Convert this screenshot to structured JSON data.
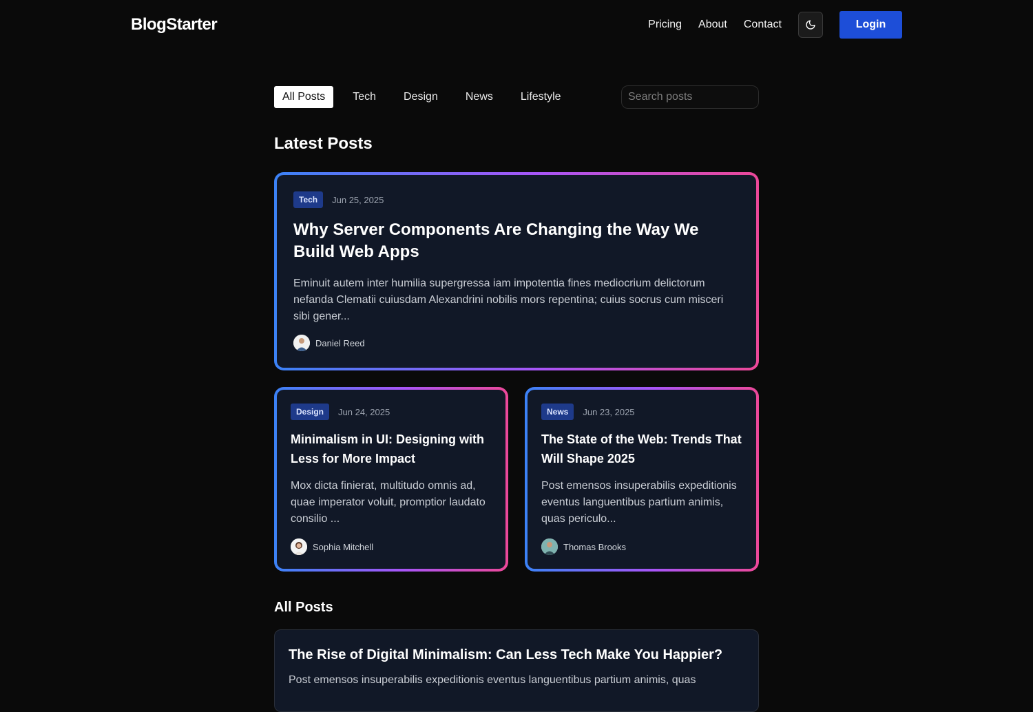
{
  "header": {
    "logo": "BlogStarter",
    "nav": [
      "Pricing",
      "About",
      "Contact"
    ],
    "theme_icon": "moon-icon",
    "login_label": "Login"
  },
  "filters": {
    "tabs": [
      "All Posts",
      "Tech",
      "Design",
      "News",
      "Lifestyle"
    ],
    "active": "All Posts",
    "search_placeholder": "Search posts"
  },
  "latest": {
    "title": "Latest Posts",
    "featured": {
      "tag": "Tech",
      "date": "Jun 25, 2025",
      "title": "Why Server Components Are Changing the Way We Build Web Apps",
      "excerpt": "Eminuit autem inter humilia supergressa iam impotentia fines mediocrium delictorum nefanda Clematii cuiusdam Alexandrini nobilis mors repentina; cuius socrus cum misceri sibi gener...",
      "author": "Daniel Reed"
    },
    "cards": [
      {
        "tag": "Design",
        "date": "Jun 24, 2025",
        "title": "Minimalism in UI: Designing with Less for More Impact",
        "excerpt": "Mox dicta finierat, multitudo omnis ad, quae imperator voluit, promptior laudato consilio ...",
        "author": "Sophia Mitchell"
      },
      {
        "tag": "News",
        "date": "Jun 23, 2025",
        "title": "The State of the Web: Trends That Will Shape 2025",
        "excerpt": "Post emensos insuperabilis expeditionis eventus languentibus partium animis, quas periculo...",
        "author": "Thomas Brooks"
      }
    ]
  },
  "all_posts": {
    "title": "All Posts",
    "items": [
      {
        "title": "The Rise of Digital Minimalism: Can Less Tech Make You Happier?",
        "excerpt": "Post emensos insuperabilis expeditionis eventus languentibus partium animis, quas"
      }
    ]
  },
  "colors": {
    "accent": "#1d4ed8",
    "tag_bg": "#1e3a8a",
    "card_bg": "#111827",
    "gradient_start": "#3b82f6",
    "gradient_mid": "#a855f7",
    "gradient_end": "#ec4899"
  }
}
